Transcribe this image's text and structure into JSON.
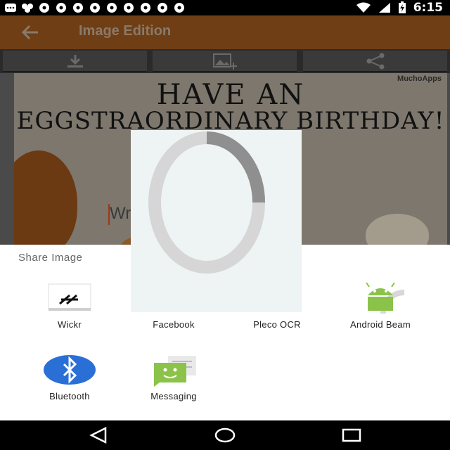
{
  "status_bar": {
    "time": "6:15",
    "notification_count": 11
  },
  "app_bar": {
    "title": "Image Edition",
    "back_icon": "arrow-back-icon"
  },
  "toolbar": {
    "buttons": [
      {
        "icon": "download-icon"
      },
      {
        "icon": "add-image-icon"
      },
      {
        "icon": "share-icon"
      }
    ]
  },
  "card": {
    "watermark": "MuchoApps",
    "line1": "HAVE AN",
    "line2": "EGGSTRAORDINARY BIRTHDAY!",
    "placeholder": "Write your text..."
  },
  "share_sheet": {
    "title": "Share Image",
    "targets": [
      {
        "label": "Wickr",
        "icon": "wickr-icon"
      },
      {
        "label": "Facebook",
        "icon": "facebook-icon"
      },
      {
        "label": "Pleco OCR",
        "icon": "pleco-icon"
      },
      {
        "label": "Android Beam",
        "icon": "android-beam-icon"
      },
      {
        "label": "Bluetooth",
        "icon": "bluetooth-icon"
      },
      {
        "label": "Messaging",
        "icon": "messaging-icon"
      }
    ]
  },
  "colors": {
    "app_bar": "#6f3e14",
    "android_green": "#8bc34a",
    "bluetooth_blue": "#2a6fd6"
  }
}
